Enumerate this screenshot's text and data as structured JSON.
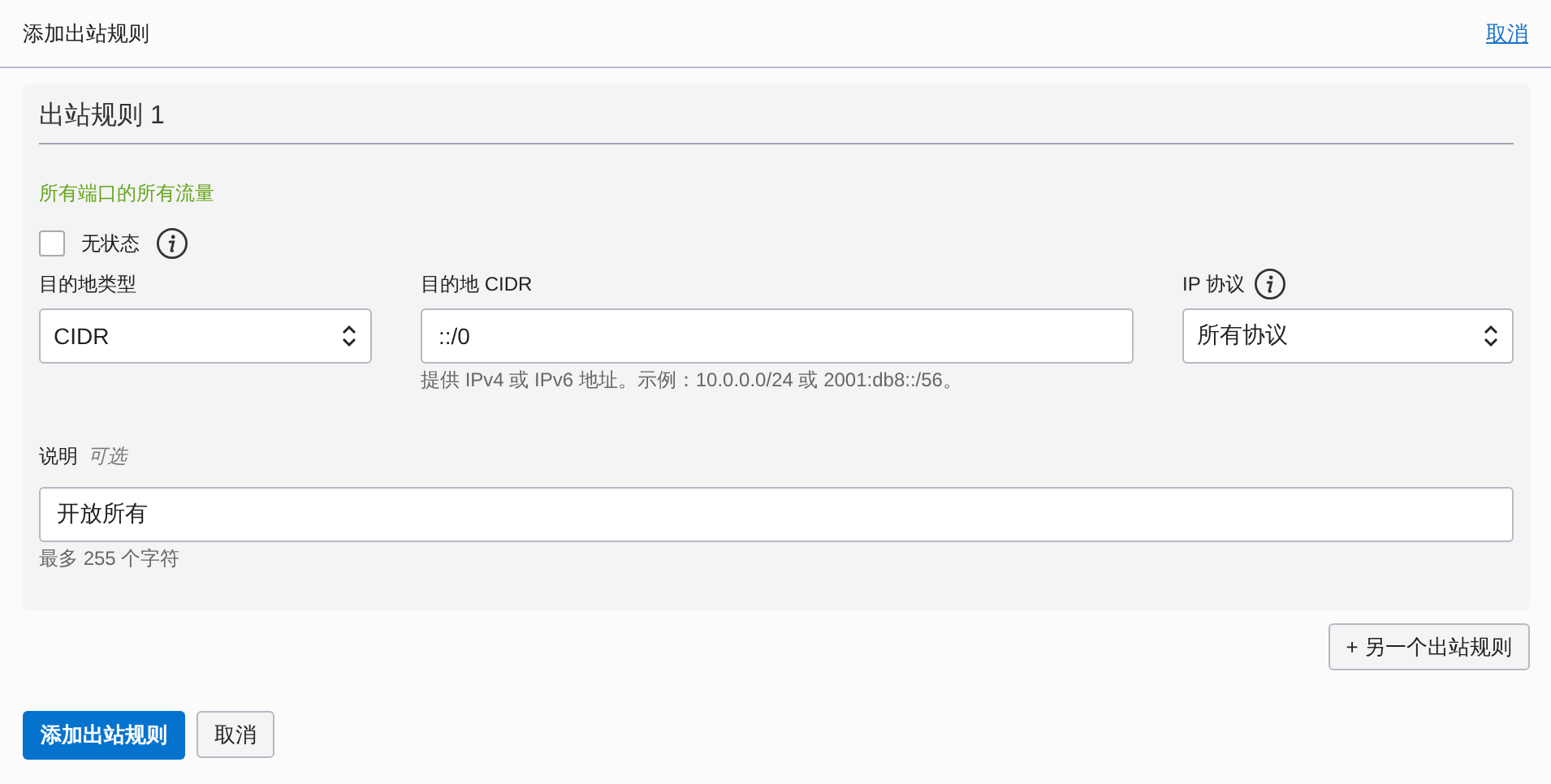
{
  "header": {
    "title": "添加出站规则",
    "cancel_link": "取消"
  },
  "rule": {
    "title": "出站规则 1",
    "summary": "所有端口的所有流量",
    "stateless": {
      "label": "无状态",
      "checked": false
    },
    "destination_type": {
      "label": "目的地类型",
      "value": "CIDR"
    },
    "destination_cidr": {
      "label": "目的地 CIDR",
      "value": "::/0",
      "help": "提供 IPv4 或 IPv6 地址。示例：10.0.0.0/24 或 2001:db8::/56。"
    },
    "ip_protocol": {
      "label": "IP 协议",
      "value": "所有协议"
    },
    "description": {
      "label": "说明",
      "optional": "可选",
      "value": "开放所有",
      "hint": "最多 255 个字符"
    }
  },
  "add_another_button": "+ 另一个出站规则",
  "footer": {
    "primary_button": "添加出站规则",
    "cancel_button": "取消"
  }
}
